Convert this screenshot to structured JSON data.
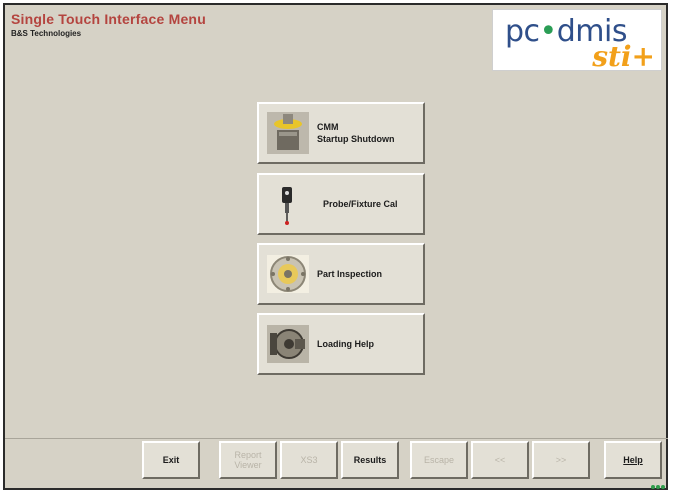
{
  "header": {
    "title": "Single Touch Interface Menu",
    "subtitle": "B&S Technologies",
    "logo_main_before": "pc",
    "logo_main_dot": "•",
    "logo_main_after": "dmis",
    "logo_sub": "sti+"
  },
  "menu": [
    {
      "label_line1": "CMM",
      "label_line2": "Startup Shutdown",
      "icon": "cmm-machine-icon"
    },
    {
      "label_line1": "Probe/Fixture Cal",
      "label_line2": "",
      "icon": "probe-icon"
    },
    {
      "label_line1": "Part Inspection",
      "label_line2": "",
      "icon": "part-gear-icon"
    },
    {
      "label_line1": "Loading Help",
      "label_line2": "",
      "icon": "loading-fixture-icon"
    }
  ],
  "toolbar": {
    "exit": "Exit",
    "report_viewer": "Report Viewer",
    "xs": "XS3",
    "results": "Results",
    "escape": "Escape",
    "prev": "<<",
    "next": ">>",
    "help": "Help"
  },
  "colors": {
    "title": "#b4443f",
    "background": "#d6d2c6",
    "logo_blue": "#2f4f8a",
    "logo_orange": "#f2a01a",
    "status_green": "#2e9c4a"
  }
}
